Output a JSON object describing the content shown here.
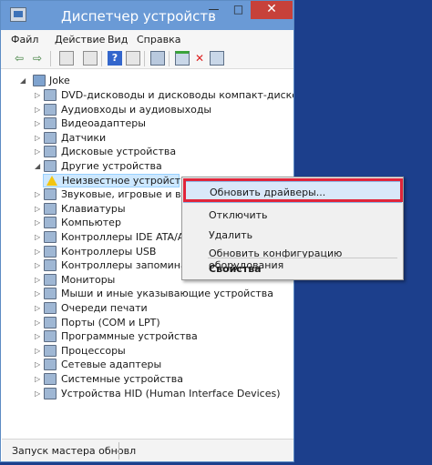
{
  "window": {
    "title": "Диспетчер устройств",
    "close_glyph": "✕",
    "minimize_glyph": "—",
    "maximize_glyph": "□"
  },
  "menu": [
    {
      "label": "Файл"
    },
    {
      "label": "Действие"
    },
    {
      "label": "Вид"
    },
    {
      "label": "Справка"
    }
  ],
  "toolbar": {
    "back_glyph": "⇦",
    "forward_glyph": "⇨",
    "icons": [
      "properties-icon",
      "view-icon",
      "help-icon",
      "panel-icon",
      "scan-hardware-icon",
      "update-driver-icon",
      "uninstall-icon",
      "disable-icon"
    ]
  },
  "tree": {
    "root": "Joke",
    "categories": [
      {
        "label": "DVD-дисководы и дисководы компакт-дисков",
        "icon": "dvd-icon"
      },
      {
        "label": "Аудиовходы и аудиовыходы",
        "icon": "audio-icon"
      },
      {
        "label": "Видеоадаптеры",
        "icon": "display-adapter-icon"
      },
      {
        "label": "Датчики",
        "icon": "sensor-icon"
      },
      {
        "label": "Дисковые устройства",
        "icon": "disk-drive-icon"
      },
      {
        "label": "Другие устройства",
        "icon": "other-devices-icon",
        "expanded": true
      },
      {
        "label": "Неизвестное устройство",
        "icon": "warning-icon",
        "child": true,
        "selected": true
      },
      {
        "label": "Звуковые, игровые и видео",
        "icon": "sound-icon"
      },
      {
        "label": "Клавиатуры",
        "icon": "keyboard-icon"
      },
      {
        "label": "Компьютер",
        "icon": "computer-icon"
      },
      {
        "label": "Контроллеры IDE ATA/ATAI",
        "icon": "ide-controller-icon"
      },
      {
        "label": "Контроллеры USB",
        "icon": "usb-controller-icon"
      },
      {
        "label": "Контроллеры запоминающ",
        "icon": "storage-controller-icon"
      },
      {
        "label": "Мониторы",
        "icon": "monitor-icon"
      },
      {
        "label": "Мыши и иные указывающие устройства",
        "icon": "mouse-icon"
      },
      {
        "label": "Очереди печати",
        "icon": "print-queue-icon"
      },
      {
        "label": "Порты (COM и LPT)",
        "icon": "ports-icon"
      },
      {
        "label": "Программные устройства",
        "icon": "software-device-icon"
      },
      {
        "label": "Процессоры",
        "icon": "processor-icon"
      },
      {
        "label": "Сетевые адаптеры",
        "icon": "network-adapter-icon"
      },
      {
        "label": "Системные устройства",
        "icon": "system-device-icon"
      },
      {
        "label": "Устройства HID (Human Interface Devices)",
        "icon": "hid-icon"
      }
    ]
  },
  "status": {
    "text": "Запуск мастера обновл"
  },
  "context_menu": {
    "items": [
      {
        "label": "Обновить драйверы...",
        "highlighted": true
      },
      {
        "label": "Отключить"
      },
      {
        "label": "Удалить"
      },
      {
        "label": "Обновить конфигурацию оборудования"
      },
      {
        "label": "Свойства",
        "bold": true
      }
    ]
  },
  "colors": {
    "desktop": "#1c3f8c",
    "titlebar": "#6a9ad6",
    "close_button": "#c7413a",
    "highlight_outline": "#e0253a",
    "selection": "#cde8ff"
  }
}
